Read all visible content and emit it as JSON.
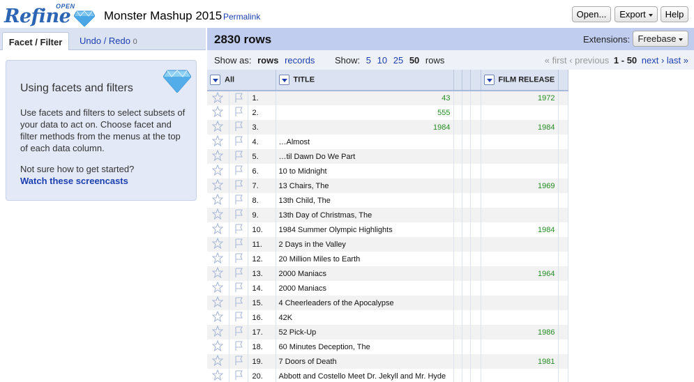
{
  "app": {
    "logo_main": "Refine",
    "logo_sup": "OPEN",
    "project_title": "Monster Mashup 2015",
    "permalink": "Permalink",
    "buttons": {
      "open": "Open...",
      "export": "Export",
      "help": "Help"
    }
  },
  "left_panel": {
    "tabs": {
      "facet": "Facet / Filter",
      "undo": "Undo / Redo",
      "undo_count": "0"
    },
    "help": {
      "title": "Using facets and filters",
      "text": "Use facets and filters to select subsets of your data to act on. Choose facet and filter methods from the menus at the top of each data column.",
      "question": "Not sure how to get started?",
      "link": "Watch these screencasts"
    }
  },
  "summary": {
    "row_count": "2830 rows",
    "extensions_label": "Extensions:",
    "extensions_button": "Freebase"
  },
  "view": {
    "show_as_label": "Show as:",
    "rows_mode": "rows",
    "records_mode": "records",
    "show_label": "Show:",
    "page_sizes": [
      "5",
      "10",
      "25"
    ],
    "page_size_current": "50",
    "rows_suffix": "rows",
    "pager": {
      "first": "« first",
      "previous": "‹ previous",
      "range": "1 - 50",
      "next": "next ›",
      "last": "last »"
    }
  },
  "columns": {
    "all": "All",
    "title": "TITLE",
    "film_release": "FILM RELEASE"
  },
  "rows": [
    {
      "idx": "1.",
      "title": "",
      "title_num": "43",
      "film_release": "1972"
    },
    {
      "idx": "2.",
      "title": "",
      "title_num": "555",
      "film_release": ""
    },
    {
      "idx": "3.",
      "title": "",
      "title_num": "1984",
      "film_release": "1984"
    },
    {
      "idx": "4.",
      "title": "…Almost",
      "title_num": "",
      "film_release": ""
    },
    {
      "idx": "5.",
      "title": "…til Dawn Do We Part",
      "title_num": "",
      "film_release": ""
    },
    {
      "idx": "6.",
      "title": "10 to Midnight",
      "title_num": "",
      "film_release": ""
    },
    {
      "idx": "7.",
      "title": "13 Chairs, The",
      "title_num": "",
      "film_release": "1969"
    },
    {
      "idx": "8.",
      "title": "13th Child, The",
      "title_num": "",
      "film_release": ""
    },
    {
      "idx": "9.",
      "title": "13th Day of Christmas, The",
      "title_num": "",
      "film_release": ""
    },
    {
      "idx": "10.",
      "title": "1984 Summer Olympic Highlights",
      "title_num": "",
      "film_release": "1984"
    },
    {
      "idx": "11.",
      "title": "2 Days in the Valley",
      "title_num": "",
      "film_release": ""
    },
    {
      "idx": "12.",
      "title": "20 Million Miles to Earth",
      "title_num": "",
      "film_release": ""
    },
    {
      "idx": "13.",
      "title": "2000 Maniacs",
      "title_num": "",
      "film_release": "1964"
    },
    {
      "idx": "14.",
      "title": "2000 Maniacs",
      "title_num": "",
      "film_release": ""
    },
    {
      "idx": "15.",
      "title": "4 Cheerleaders of the Apocalypse",
      "title_num": "",
      "film_release": ""
    },
    {
      "idx": "16.",
      "title": "42K",
      "title_num": "",
      "film_release": ""
    },
    {
      "idx": "17.",
      "title": "52 Pick-Up",
      "title_num": "",
      "film_release": "1986"
    },
    {
      "idx": "18.",
      "title": "60 Minutes Deception, The",
      "title_num": "",
      "film_release": ""
    },
    {
      "idx": "19.",
      "title": "7 Doors of Death",
      "title_num": "",
      "film_release": "1981"
    },
    {
      "idx": "20.",
      "title": "Abbott and Costello Meet Dr. Jekyll and Mr. Hyde",
      "title_num": "",
      "film_release": ""
    }
  ],
  "icons": {
    "star": "star-icon",
    "flag": "flag-icon",
    "diamond": "diamond-logo-icon"
  },
  "colors": {
    "link": "#1b3fb0",
    "number": "#258c25",
    "header_bar": "#c0cdef"
  }
}
